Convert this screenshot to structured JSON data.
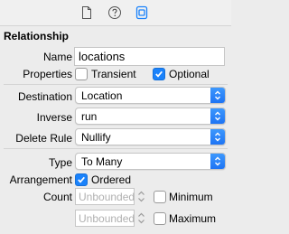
{
  "tabs": [
    {
      "icon": "file-icon"
    },
    {
      "icon": "help-icon"
    },
    {
      "icon": "relationship-inspector-icon",
      "selected": true
    }
  ],
  "section_title": "Relationship",
  "name": {
    "label": "Name",
    "value": "locations"
  },
  "properties": {
    "label": "Properties",
    "transient": {
      "label": "Transient",
      "checked": false
    },
    "optional": {
      "label": "Optional",
      "checked": true
    }
  },
  "destination": {
    "label": "Destination",
    "value": "Location"
  },
  "inverse": {
    "label": "Inverse",
    "value": "run"
  },
  "delete_rule": {
    "label": "Delete Rule",
    "value": "Nullify"
  },
  "type": {
    "label": "Type",
    "value": "To Many"
  },
  "arrangement": {
    "label": "Arrangement",
    "ordered": {
      "label": "Ordered",
      "checked": true
    }
  },
  "count": {
    "label": "Count",
    "minimum": {
      "placeholder": "Unbounded",
      "label": "Minimum",
      "checked": false
    },
    "maximum": {
      "placeholder": "Unbounded",
      "label": "Maximum",
      "checked": false
    }
  },
  "colors": {
    "accent": "#1a82fb",
    "background": "#ececec"
  }
}
